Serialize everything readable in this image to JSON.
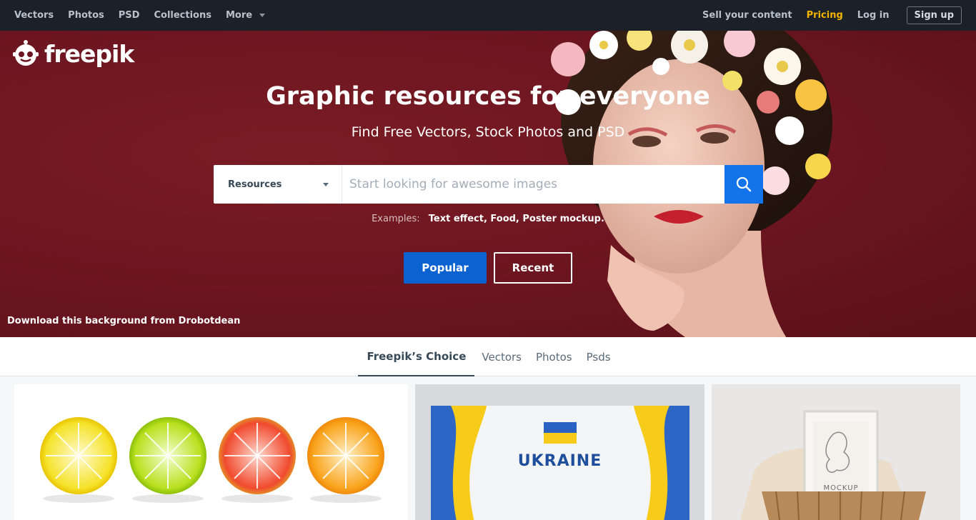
{
  "nav": {
    "left": [
      "Vectors",
      "Photos",
      "PSD",
      "Collections"
    ],
    "more_label": "More",
    "sell": "Sell your content",
    "pricing": "Pricing",
    "login": "Log in",
    "signup": "Sign up"
  },
  "brand": {
    "logo_text": "freepik"
  },
  "hero": {
    "title": "Graphic resources for everyone",
    "subtitle": "Find Free Vectors, Stock Photos and PSD",
    "search": {
      "type_label": "Resources",
      "placeholder": "Start looking for awesome images"
    },
    "examples_label": "Examples:",
    "examples_items": "Text effect, Food, Poster mockup.",
    "popular_label": "Popular",
    "recent_label": "Recent",
    "credit": "Download this background from Drobotdean"
  },
  "tabs": [
    "Freepik’s Choice",
    "Vectors",
    "Photos",
    "Psds"
  ],
  "cards": {
    "ukraine_text": "UKRAINE",
    "mockup_text": "MOCKUP"
  },
  "colors": {
    "nav_bg": "#1b2029",
    "hero_bg": "#6b1520",
    "accent_blue": "#1273eb",
    "pricing": "#f4b400"
  }
}
